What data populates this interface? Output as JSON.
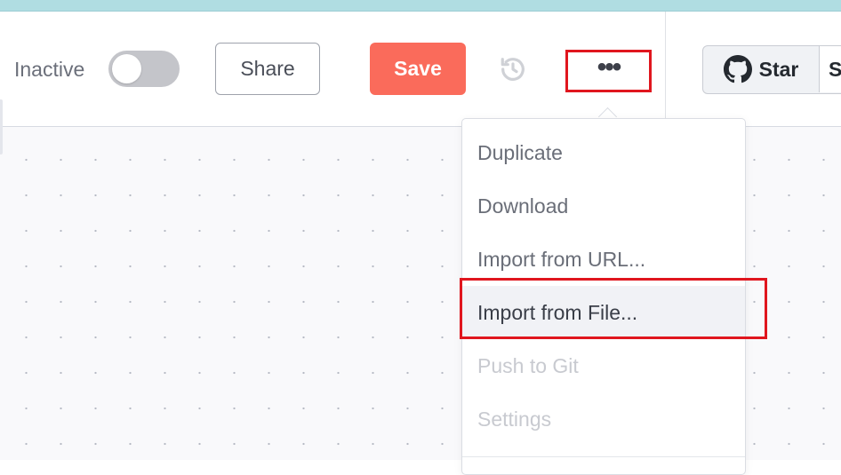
{
  "header": {
    "status_label": "Inactive",
    "toggle_state": "off",
    "share_label": "Share",
    "save_label": "Save",
    "history_icon": "history-icon",
    "more_icon": "more-horizontal-icon",
    "more_label": "•••",
    "github": {
      "icon": "github-icon",
      "star_label": "Star",
      "count_fragment": "S"
    }
  },
  "more_menu": {
    "items": [
      {
        "label": "Duplicate",
        "enabled": true
      },
      {
        "label": "Download",
        "enabled": true
      },
      {
        "label": "Import from URL...",
        "enabled": true
      },
      {
        "label": "Import from File...",
        "enabled": true,
        "highlighted": true
      },
      {
        "label": "Push to Git",
        "enabled": false
      },
      {
        "label": "Settings",
        "enabled": false
      }
    ]
  },
  "colors": {
    "top_strip": "#b0dde2",
    "save_button": "#fa6b5b",
    "annotation_outline": "#e0161e",
    "canvas_background": "#f9f9fb"
  }
}
